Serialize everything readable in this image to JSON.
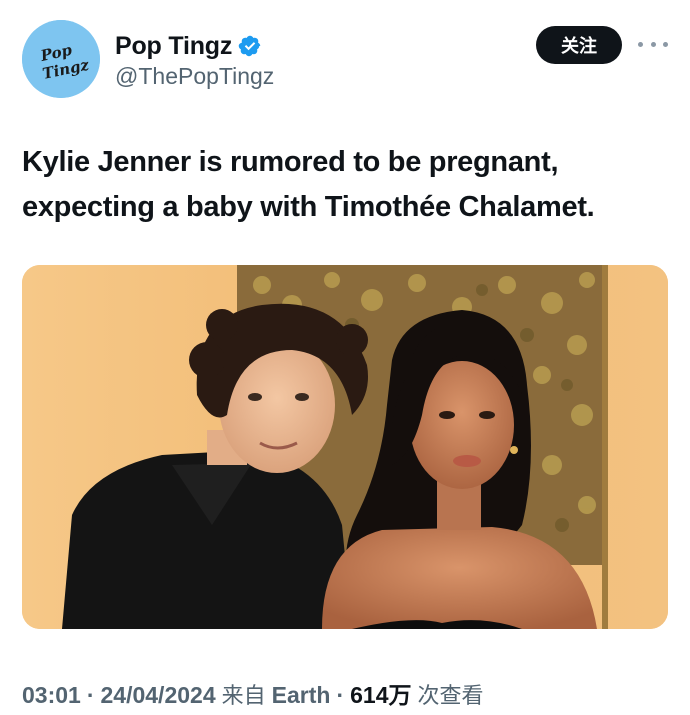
{
  "author": {
    "display_name": "Pop Tingz",
    "handle": "@ThePopTingz",
    "avatar_text": "Pop Tingz",
    "verified_icon": "verified-badge-icon"
  },
  "actions": {
    "follow_label": "关注",
    "more_icon": "more-icon"
  },
  "tweet": {
    "text": "Kylie Jenner is rumored to be pregnant, expecting a baby with Timothée Chalamet."
  },
  "meta": {
    "time": "03:01",
    "separator": "·",
    "date": "24/04/2024",
    "source_prefix": "来自",
    "source": "Earth",
    "views_count": "614万",
    "views_label": "次查看"
  },
  "colors": {
    "verified": "#1d9bf0",
    "avatar_bg": "#7ec5f0",
    "follow_bg": "#0f1419",
    "secondary_text": "#536471",
    "media_bg": "#f1bf7a"
  }
}
